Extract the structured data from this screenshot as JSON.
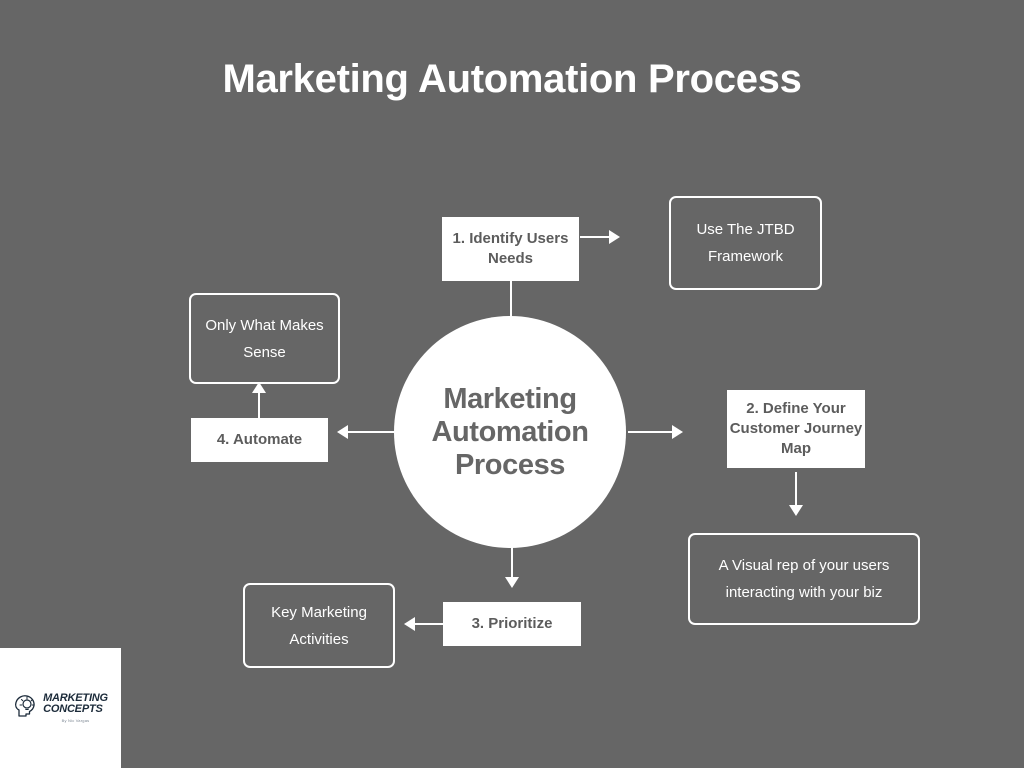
{
  "page": {
    "title": "Marketing Automation Process",
    "background_color": "#666666",
    "accent_color": "#ffffff",
    "text_color_on_white": "#5c5c5c"
  },
  "hub": {
    "label": "Marketing Automation Process"
  },
  "steps": [
    {
      "id": "step-1",
      "label": "1. Identify Users Needs",
      "note": "Use The JTBD Framework"
    },
    {
      "id": "step-2",
      "label": "2. Define Your Customer Journey Map",
      "note": "A Visual rep of your users interacting with your biz"
    },
    {
      "id": "step-3",
      "label": "3. Prioritize",
      "note": "Key Marketing Activities"
    },
    {
      "id": "step-4",
      "label": "4. Automate",
      "note": "Only What Makes Sense"
    }
  ],
  "logo": {
    "line1": "MARKETING",
    "line2": "CONCEPTS",
    "byline": "By Nic Vargas",
    "icon": "head-lightbulb-icon",
    "brand_color": "#1c2b3a"
  }
}
